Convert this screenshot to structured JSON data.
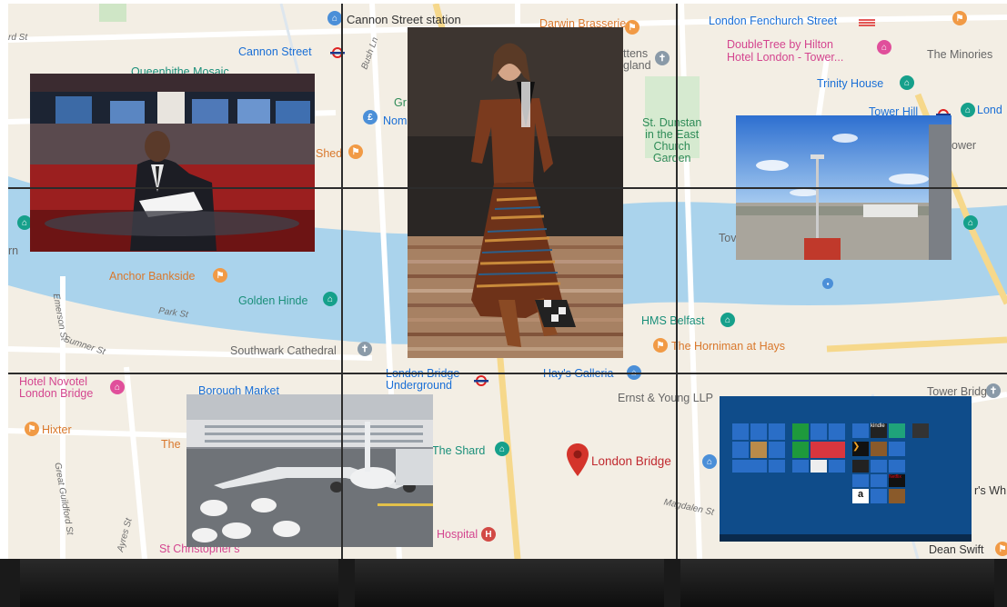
{
  "map": {
    "places": [
      {
        "key": "cannon_street_station",
        "text": "Cannon Street station"
      },
      {
        "key": "cannon_street",
        "text": "Cannon Street"
      },
      {
        "key": "queenhithe",
        "text": "Queenhithe Mosaic"
      },
      {
        "key": "bush_ln",
        "text": "Bush Ln"
      },
      {
        "key": "nom",
        "text": "Nom"
      },
      {
        "key": "gr",
        "text": "Gr"
      },
      {
        "key": "shed",
        "text": "Shed"
      },
      {
        "key": "anchor",
        "text": "Anchor Bankside"
      },
      {
        "key": "golden_hinde",
        "text": "Golden Hinde"
      },
      {
        "key": "park_st",
        "text": "Park St"
      },
      {
        "key": "sumner_st",
        "text": "Sumner St"
      },
      {
        "key": "emerson_st",
        "text": "Emerson St"
      },
      {
        "key": "southwark",
        "text": "Southwark Cathedral"
      },
      {
        "key": "hotel_novotel",
        "text": "Hotel Novotel\nLondon Bridge"
      },
      {
        "key": "borough_market",
        "text": "Borough Market"
      },
      {
        "key": "hixter",
        "text": "Hixter"
      },
      {
        "key": "the",
        "text": "The"
      },
      {
        "key": "great_guildford",
        "text": "Great Guildford St"
      },
      {
        "key": "ayres_st",
        "text": "Ayres St"
      },
      {
        "key": "st_christophers",
        "text": "St Christopher's"
      },
      {
        "key": "london_bridge_ug",
        "text": "London Bridge\nUnderground"
      },
      {
        "key": "hays_galleria",
        "text": "Hay's Galleria"
      },
      {
        "key": "the_shard",
        "text": "The Shard"
      },
      {
        "key": "hospital",
        "text": "Hospital"
      },
      {
        "key": "london_bridge",
        "text": "London Bridge"
      },
      {
        "key": "ernst",
        "text": "Ernst & Young LLP"
      },
      {
        "key": "tower_bridge",
        "text": "Tower Bridge"
      },
      {
        "key": "magdalen",
        "text": "Magdalen St"
      },
      {
        "key": "rs_wh",
        "text": "r's Wh"
      },
      {
        "key": "dean_swift",
        "text": "Dean Swift"
      },
      {
        "key": "london_fenchurch",
        "text": "London Fenchurch Street"
      },
      {
        "key": "doubletree",
        "text": "DoubleTree by Hilton\nHotel London - Tower..."
      },
      {
        "key": "the_minories",
        "text": "The Minories"
      },
      {
        "key": "trinity_house",
        "text": "Trinity House"
      },
      {
        "key": "tower_hill",
        "text": "Tower Hill"
      },
      {
        "key": "lond",
        "text": "Lond"
      },
      {
        "key": "ower",
        "text": "ower"
      },
      {
        "key": "st_dunstan",
        "text": "St. Dunstan\nin the East\nChurch\nGarden"
      },
      {
        "key": "ttens",
        "text": "ttens\ngland"
      },
      {
        "key": "hms_belfast",
        "text": "HMS Belfast"
      },
      {
        "key": "horniman",
        "text": "The Horniman at Hays"
      },
      {
        "key": "tov",
        "text": "Tov"
      },
      {
        "key": "rd_st",
        "text": "rd St"
      },
      {
        "key": "rn",
        "text": "rn"
      },
      {
        "key": "daunis",
        "text": "Darwin Brasserie"
      }
    ]
  },
  "tiles": {
    "app_labels": [
      "kindle",
      "Netflix",
      "a"
    ]
  },
  "colors": {
    "water": "#a9d3ec",
    "land": "#f3eee4",
    "road": "#ffffff",
    "major_road": "#f7d98b",
    "bezel": "#2c2c2c",
    "win_blue": "#0f4c8a"
  }
}
